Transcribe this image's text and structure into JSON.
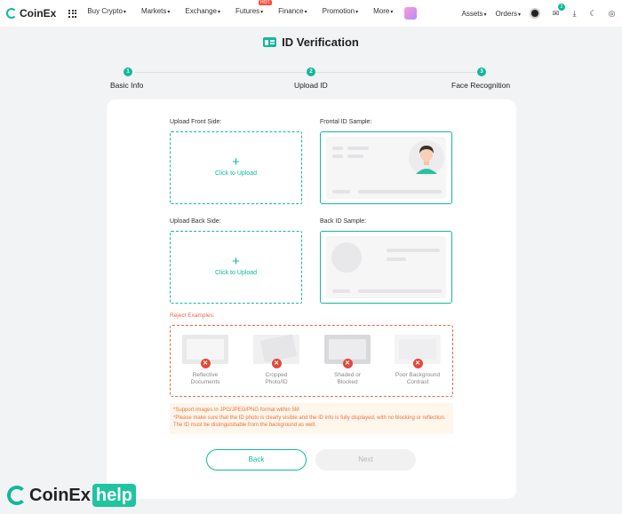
{
  "nav": {
    "brand": "CoinEx",
    "menu": [
      {
        "label": "Buy Crypto"
      },
      {
        "label": "Markets"
      },
      {
        "label": "Exchange"
      },
      {
        "label": "Futures",
        "badge": "HOT"
      },
      {
        "label": "Finance"
      },
      {
        "label": "Promotion"
      },
      {
        "label": "More"
      }
    ],
    "assets": "Assets",
    "orders": "Orders",
    "notification_count": "2",
    "icons": [
      "grid-icon",
      "gift-icon",
      "avatar",
      "message-icon",
      "download-icon",
      "moon-icon",
      "globe-icon"
    ]
  },
  "page": {
    "title": "ID Verification"
  },
  "steps": [
    {
      "num": "1",
      "label": "Basic Info"
    },
    {
      "num": "2",
      "label": "Upload ID"
    },
    {
      "num": "3",
      "label": "Face Recognition"
    }
  ],
  "upload": {
    "front_label": "Upload Front Side:",
    "front_sample_label": "Frontal ID Sample:",
    "back_label": "Upload Back Side:",
    "back_sample_label": "Back ID Sample:",
    "click_to_upload": "Click to Upload",
    "plus": "+"
  },
  "reject": {
    "label": "Reject Examples:",
    "items": [
      {
        "line1": "Reflective",
        "line2": "Documents"
      },
      {
        "line1": "Cropped",
        "line2": "Photo/ID"
      },
      {
        "line1": "Shaded or",
        "line2": "Blocked"
      },
      {
        "line1": "Poor Background",
        "line2": "Contrast"
      }
    ]
  },
  "notice": {
    "line1": "*Support images in JPG/JPEG/PNG format within 5M",
    "line2": "*Please make sure that the ID photo is clearly visible and the ID info is fully displayed, with no blocking or reflection. The ID must be distinguishable from the background as well."
  },
  "buttons": {
    "back": "Back",
    "next": "Next"
  },
  "watermark": {
    "brand": "CoinEx",
    "help": "help"
  },
  "colors": {
    "accent": "#10b99a",
    "error": "#e04a3a",
    "notice_text": "#e8743e",
    "notice_bg": "#fff6ec"
  }
}
